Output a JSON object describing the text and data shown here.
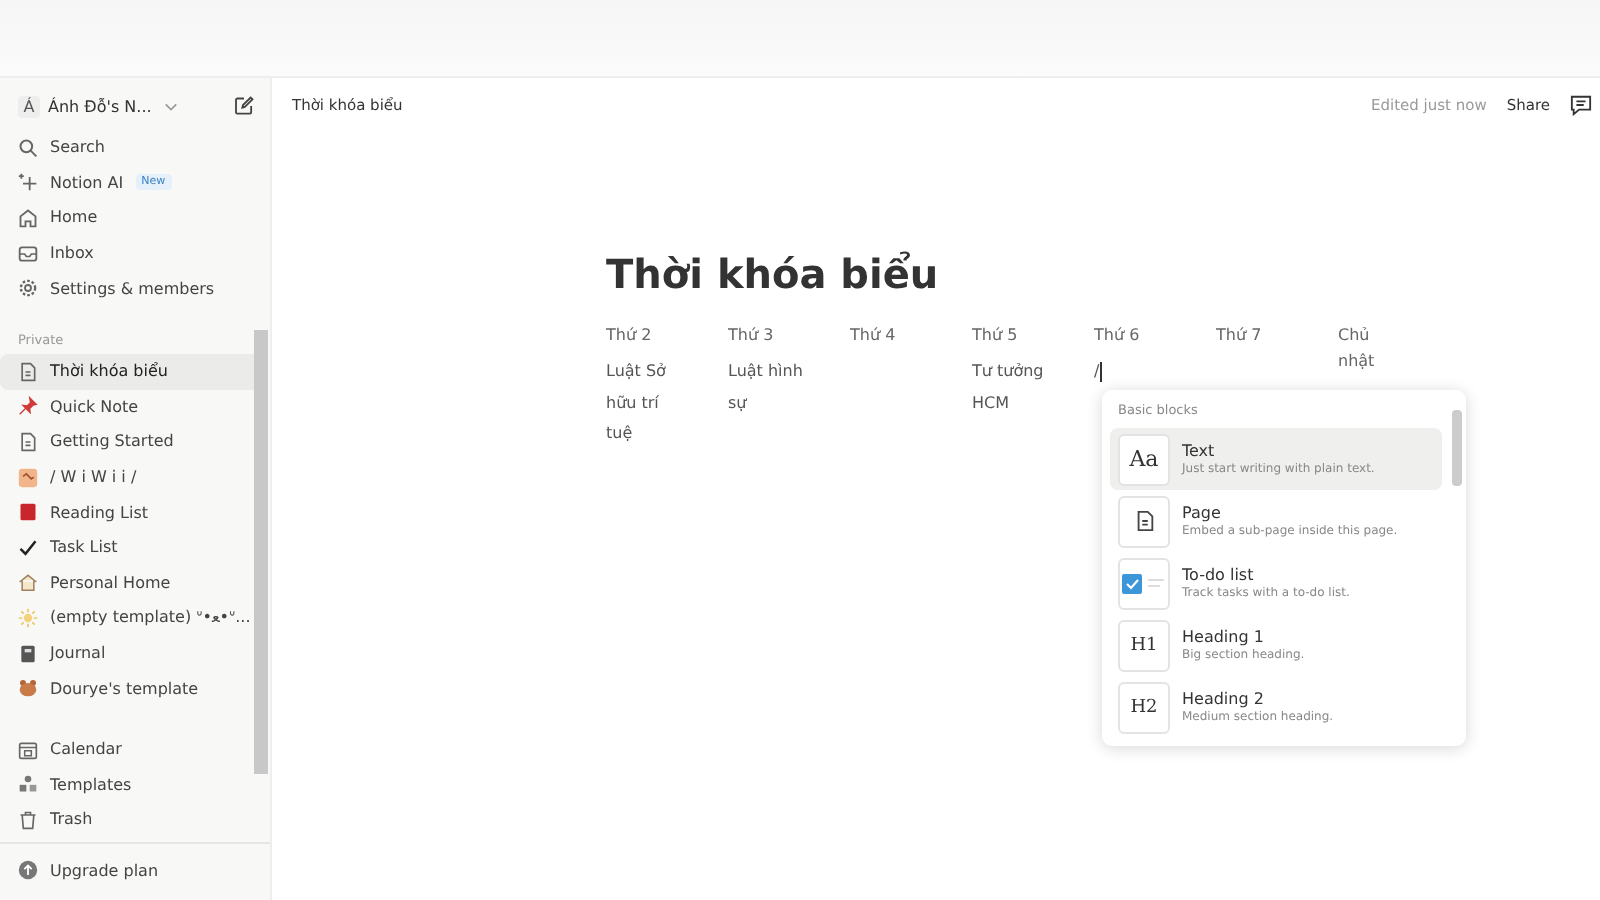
{
  "workspace": {
    "initial": "Á",
    "name": "Ánh Đỗ's N..."
  },
  "nav": [
    {
      "kind": "search",
      "label": "Search"
    },
    {
      "kind": "sparkle",
      "label": "Notion AI",
      "badge": "New"
    },
    {
      "kind": "home",
      "label": "Home"
    },
    {
      "kind": "inbox",
      "label": "Inbox"
    },
    {
      "kind": "gear",
      "label": "Settings & members"
    }
  ],
  "section_label": "Private",
  "pages": [
    {
      "kind": "page",
      "label": "Thời khóa biểu",
      "selected": true
    },
    {
      "kind": "pin",
      "label": "Quick Note",
      "selected": false
    },
    {
      "kind": "page",
      "label": "Getting Started",
      "selected": false
    },
    {
      "kind": "image",
      "label": "/ W i W i i /",
      "selected": false
    },
    {
      "kind": "book",
      "label": "Reading List",
      "selected": false
    },
    {
      "kind": "check",
      "label": "Task List",
      "selected": false
    },
    {
      "kind": "house",
      "label": "Personal Home",
      "selected": false
    },
    {
      "kind": "sun",
      "label": "(empty template) ᐡ•ﻌ•ᐡ...",
      "selected": false
    },
    {
      "kind": "journal",
      "label": "Journal",
      "selected": false
    },
    {
      "kind": "bear",
      "label": "Dourye's template",
      "selected": false
    }
  ],
  "tools": [
    {
      "kind": "calendar",
      "label": "Calendar"
    },
    {
      "kind": "shapes",
      "label": "Templates"
    },
    {
      "kind": "trash",
      "label": "Trash"
    }
  ],
  "upgrade": "Upgrade plan",
  "breadcrumb": "Thời khóa biểu",
  "edited": "Edited just now",
  "share": "Share",
  "title": "Thời khóa biểu",
  "columns": [
    {
      "header": "Thứ 2",
      "content": "Luật Sở hữu trí tuệ"
    },
    {
      "header": "Thứ 3",
      "content": "Luật hình sự"
    },
    {
      "header": "Thứ 4"
    },
    {
      "header": "Thứ 5",
      "content": "Tư tưởng HCM"
    },
    {
      "header": "Thứ 6",
      "content": "/",
      "editing": true
    },
    {
      "header": "Thứ 7"
    },
    {
      "header": "Chủ nhật"
    }
  ],
  "menu": {
    "heading": "Basic blocks",
    "items": [
      {
        "kind": "glyph",
        "glyph": "Aa",
        "title": "Text",
        "description": "Just start writing with plain text.",
        "selected": true
      },
      {
        "kind": "page",
        "title": "Page",
        "description": "Embed a sub-page inside this page.",
        "selected": false
      },
      {
        "kind": "todo",
        "title": "To-do list",
        "description": "Track tasks with a to-do list.",
        "selected": false
      },
      {
        "kind": "heading",
        "glyph": "H1",
        "title": "Heading 1",
        "description": "Big section heading.",
        "selected": false
      },
      {
        "kind": "heading",
        "glyph": "H2",
        "title": "Heading 2",
        "description": "Medium section heading.",
        "selected": false
      }
    ]
  }
}
